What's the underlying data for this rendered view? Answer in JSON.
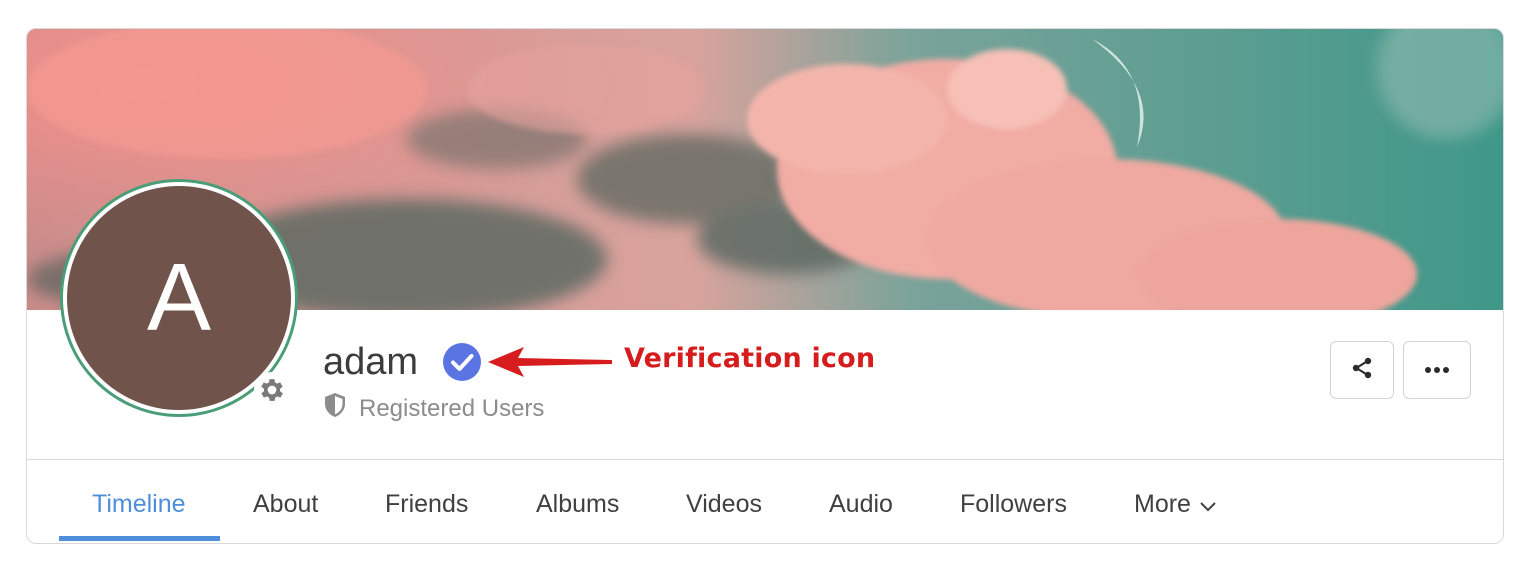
{
  "profile": {
    "avatar_initial": "A",
    "avatar_color": "#70534a",
    "avatar_border_color": "#4a9e77",
    "username": "adam",
    "role": "Registered Users",
    "verified": true,
    "verify_color": "#5b74e3"
  },
  "annotation": {
    "label": "Verification icon",
    "color": "#d61c1c"
  },
  "actions": {
    "share_icon": "share-icon",
    "more_icon": "ellipsis-icon"
  },
  "tabs": [
    {
      "label": "Timeline",
      "active": true
    },
    {
      "label": "About",
      "active": false
    },
    {
      "label": "Friends",
      "active": false
    },
    {
      "label": "Albums",
      "active": false
    },
    {
      "label": "Videos",
      "active": false
    },
    {
      "label": "Audio",
      "active": false
    },
    {
      "label": "Followers",
      "active": false
    },
    {
      "label": "More",
      "active": false
    }
  ],
  "colors": {
    "accent": "#4e8edb"
  }
}
